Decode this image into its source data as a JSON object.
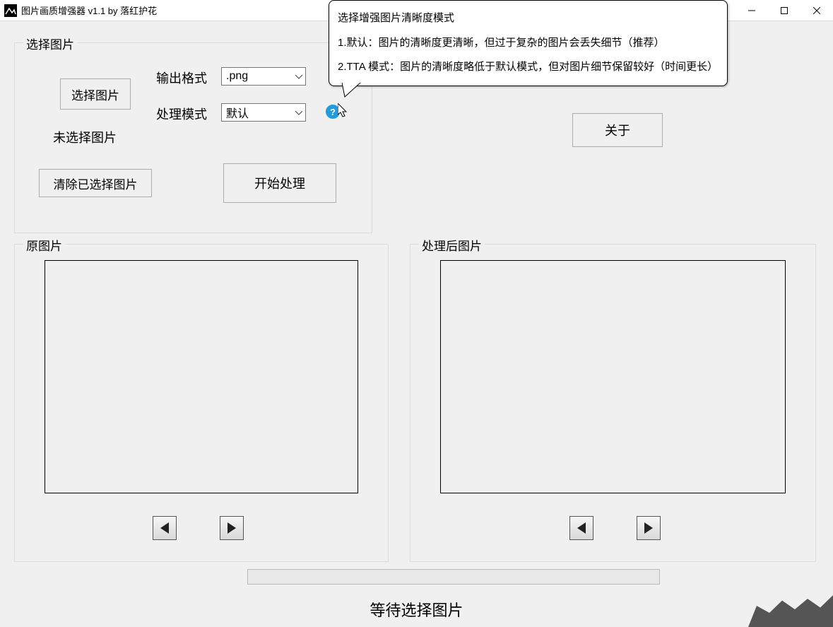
{
  "window": {
    "title": "图片画质增强器 v1.1      by 落红护花"
  },
  "select_group": {
    "legend": "选择图片",
    "choose_btn": "选择图片",
    "status_text": "未选择图片",
    "clear_btn": "清除已选择图片",
    "out_fmt_label": "输出格式",
    "out_fmt_value": ".png",
    "mode_label": "处理模式",
    "mode_value": "默认",
    "start_btn": "开始处理",
    "help_icon": "?"
  },
  "about_btn": "关于",
  "preview_orig": {
    "legend": "原图片"
  },
  "preview_proc": {
    "legend": "处理后图片"
  },
  "status": "等待选择图片",
  "tooltip": {
    "line1": "选择增强图片清晰度模式",
    "line2": "1.默认：图片的清晰度更清晰，但过于复杂的图片会丢失细节（推荐）",
    "line3": "2.TTA 模式：图片的清晰度略低于默认模式，但对图片细节保留较好（时间更长）"
  }
}
